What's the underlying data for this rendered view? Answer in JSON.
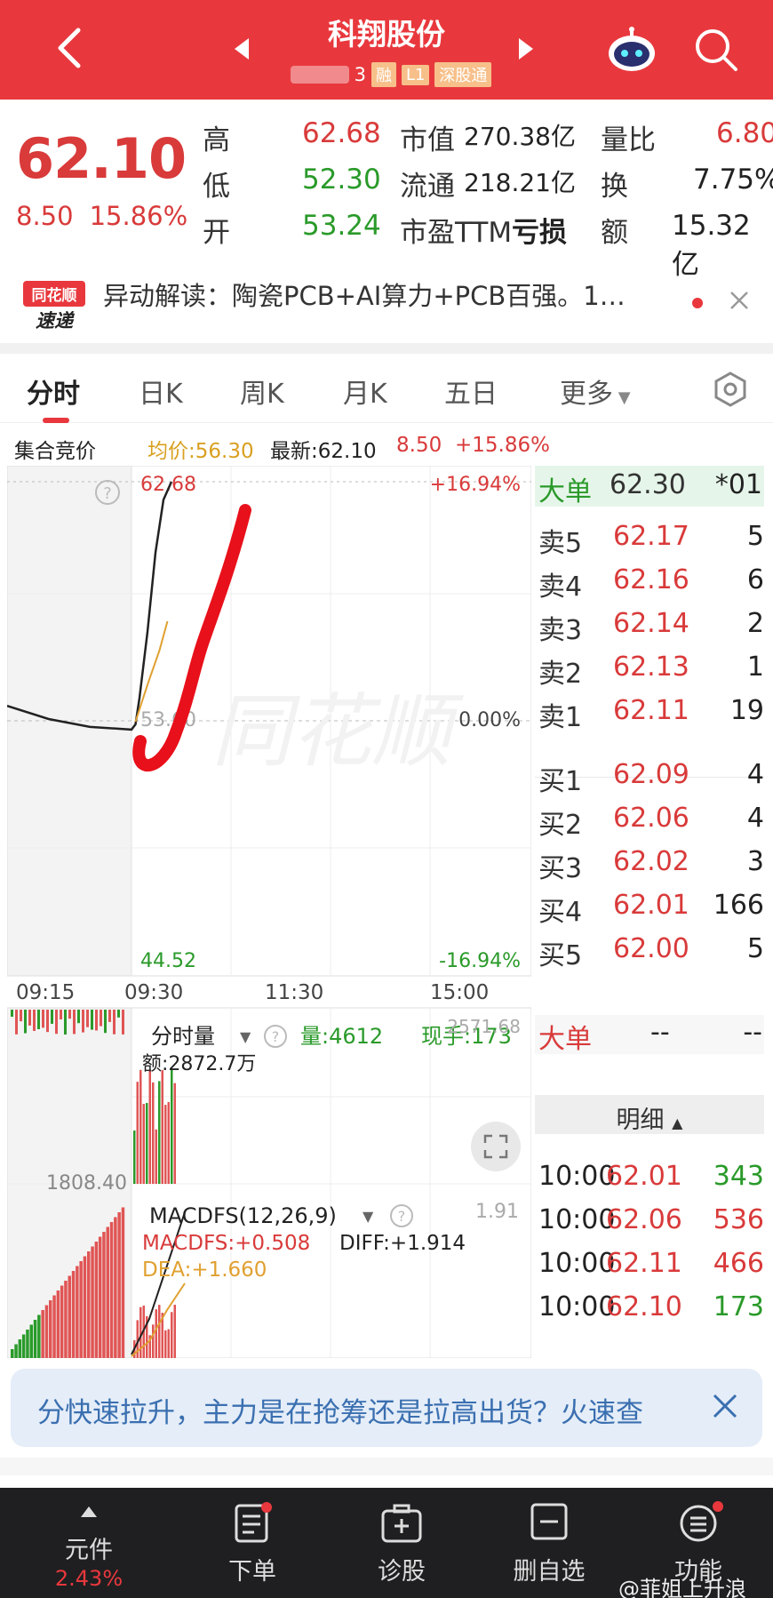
{
  "header": {
    "title": "科翔股份",
    "code_suffix": "3",
    "tags": [
      "融",
      "L1",
      "深股通"
    ]
  },
  "quote": {
    "price": "62.10",
    "change": "8.50",
    "change_pct": "15.86%",
    "cells": [
      {
        "label": "高",
        "value": "62.68"
      },
      {
        "label": "低",
        "value": "52.30"
      },
      {
        "label": "开",
        "value": "53.24"
      },
      {
        "label": "市值",
        "value": "270.38亿"
      },
      {
        "label": "流通",
        "value": "218.21亿"
      },
      {
        "label": "市盈TTM",
        "value": "亏损"
      },
      {
        "label": "量比",
        "value": "6.80"
      },
      {
        "label": "换",
        "value": "7.75%"
      },
      {
        "label": "额",
        "value": "15.32亿"
      }
    ]
  },
  "news": {
    "logo_top": "同花顺",
    "logo_bottom": "速递",
    "text": "异动解读：陶瓷PCB+AI算力+PCB百强。1…"
  },
  "tabs": [
    "分时",
    "日K",
    "周K",
    "月K",
    "五日",
    "更多"
  ],
  "info_bar": {
    "label": "集合竞价",
    "avg": "均价:56.30",
    "latest": "最新:62.10",
    "change": "8.50",
    "pct": "+15.86%"
  },
  "chart": {
    "y_high": "62.68",
    "y_pct_high": "+16.94%",
    "y_mid": "53.60",
    "y_pct_mid": "0.00%",
    "y_low": "44.52",
    "y_pct_low": "-16.94%",
    "x_labels": [
      "09:15",
      "09:30",
      "11:30",
      "15:00"
    ],
    "watermark": "同花顺",
    "vol_title": "分时量",
    "vol_amount": "量:4612",
    "vol_now": "现手:173",
    "vol_right": "2571.68",
    "vol_amt": "额:2872.7万",
    "vol_left": "1808.40",
    "macd_title": "MACDFS(12,26,9)",
    "macd_val": "MACDFS:+0.508",
    "diff": "DIFF:+1.914",
    "dea": "DEA:+1.660",
    "macd_right": "1.91"
  },
  "chart_data": {
    "type": "line",
    "title": "",
    "xlabel": "",
    "ylabel": "",
    "x_ticks": [
      "09:15",
      "09:30",
      "11:30",
      "15:00"
    ],
    "ylim": [
      44.52,
      62.68
    ],
    "series": [
      {
        "values": [
          [
            0,
            54.2
          ],
          [
            5,
            53.7
          ],
          [
            10,
            53.4
          ],
          [
            15,
            53.3
          ],
          [
            15.5,
            53.5
          ],
          [
            16,
            54.5
          ],
          [
            17,
            57.0
          ],
          [
            18,
            60.0
          ],
          [
            19,
            62.0
          ],
          [
            20,
            62.68
          ]
        ]
      },
      {
        "values": [
          [
            15.5,
            53.6
          ],
          [
            17,
            55.0
          ],
          [
            18.5,
            56.3
          ],
          [
            19.5,
            57.4
          ]
        ]
      }
    ]
  },
  "order_book": {
    "big": {
      "label": "大单",
      "price": "62.30",
      "vol": "*01"
    },
    "sells": [
      {
        "label": "卖5",
        "price": "62.17",
        "vol": "5"
      },
      {
        "label": "卖4",
        "price": "62.16",
        "vol": "6"
      },
      {
        "label": "卖3",
        "price": "62.14",
        "vol": "2"
      },
      {
        "label": "卖2",
        "price": "62.13",
        "vol": "1"
      },
      {
        "label": "卖1",
        "price": "62.11",
        "vol": "19"
      }
    ],
    "buys": [
      {
        "label": "买1",
        "price": "62.09",
        "vol": "4"
      },
      {
        "label": "买2",
        "price": "62.06",
        "vol": "4"
      },
      {
        "label": "买3",
        "price": "62.02",
        "vol": "3"
      },
      {
        "label": "买4",
        "price": "62.01",
        "vol": "166"
      },
      {
        "label": "买5",
        "price": "62.00",
        "vol": "5"
      }
    ],
    "big2": {
      "label": "大单",
      "a": "--",
      "b": "--"
    },
    "detail_label": "明细",
    "ticks": [
      {
        "time": "10:00",
        "price": "62.01",
        "vol": "343"
      },
      {
        "time": "10:00",
        "price": "62.06",
        "vol": "536"
      },
      {
        "time": "10:00",
        "price": "62.11",
        "vol": "466"
      },
      {
        "time": "10:00",
        "price": "62.10",
        "vol": "173"
      }
    ]
  },
  "banner": {
    "text": "分快速拉升，主力是在抢筹还是拉高出货？火速查"
  },
  "bottom_nav": [
    {
      "label": "元件",
      "sub": "2.43%"
    },
    {
      "label": "下单"
    },
    {
      "label": "诊股"
    },
    {
      "label": "删自选"
    },
    {
      "label": "功能"
    }
  ],
  "watermark_user": "@菲姐上升浪",
  "colors": {
    "brand": "#e8383d",
    "up": "#d93a3a",
    "down": "#2a9a2a",
    "avg": "#e0a030",
    "annotation": "#e8101a"
  }
}
